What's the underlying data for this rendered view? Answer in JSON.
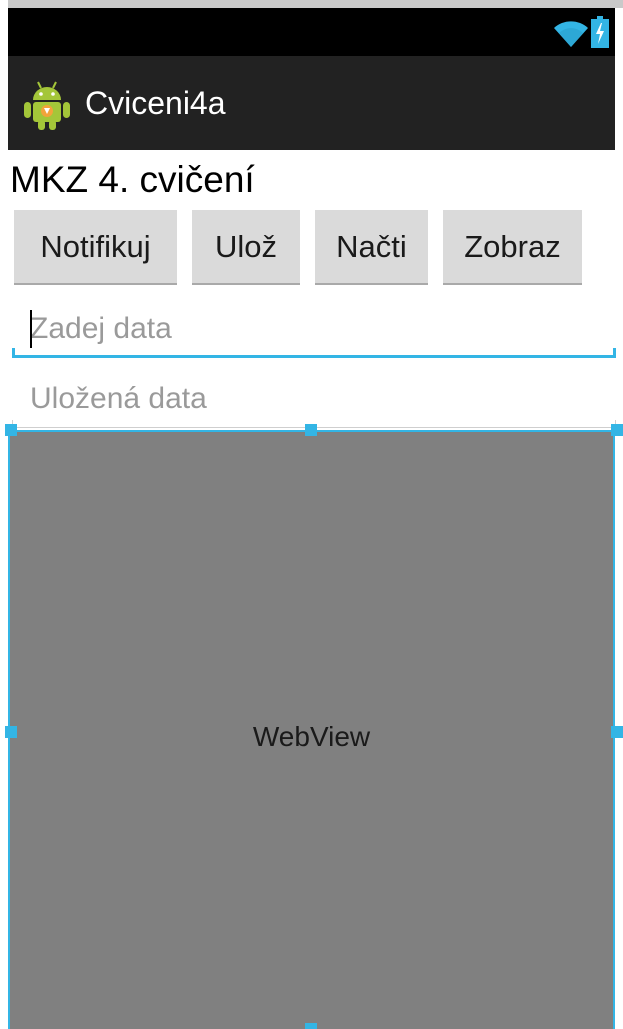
{
  "status_bar": {
    "icons": [
      "wifi-icon",
      "battery-charging-icon"
    ],
    "background": "#000000"
  },
  "action_bar": {
    "app_icon": "android-robot-icon",
    "title": "Cviceni4a",
    "background": "#222222"
  },
  "main": {
    "heading": "MKZ 4. cvičení",
    "buttons": {
      "notify": "Notifikuj",
      "save": "Ulož",
      "load": "Načti",
      "show": "Zobraz"
    },
    "data_input": {
      "placeholder": "Zadej data",
      "value": ""
    },
    "saved_data_input": {
      "placeholder": "Uložená data",
      "value": ""
    },
    "webview": {
      "label": "WebView",
      "background": "#808080"
    }
  },
  "colors": {
    "accent": "#33b5e5",
    "button": "#dadada"
  }
}
